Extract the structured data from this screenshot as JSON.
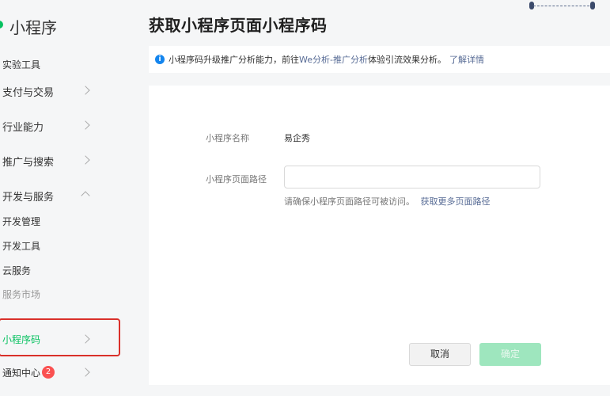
{
  "sidebar": {
    "app_title": "小程序",
    "items": [
      {
        "label": "实验工具"
      },
      {
        "label": "支付与交易"
      },
      {
        "label": "行业能力"
      },
      {
        "label": "推广与搜索"
      },
      {
        "label": "开发与服务"
      },
      {
        "label": "开发管理"
      },
      {
        "label": "开发工具"
      },
      {
        "label": "云服务"
      },
      {
        "label": "服务市场"
      },
      {
        "label": "小程序码"
      },
      {
        "label": "通知中心",
        "badge": "2"
      }
    ]
  },
  "main": {
    "title": "获取小程序页面小程序码",
    "notice": {
      "icon": "info-icon",
      "text_before": "小程序码升级推广分析能力，前往",
      "link1": "We分析-推广分析",
      "text_after": "体验引流效果分析。",
      "link2": "了解详情"
    },
    "form": {
      "name_label": "小程序名称",
      "name_value": "易企秀",
      "path_label": "小程序页面路径",
      "path_value": "",
      "hint_text": "请确保小程序页面路径可被访问。",
      "hint_link": "获取更多页面路径"
    },
    "buttons": {
      "cancel": "取消",
      "confirm": "确定"
    }
  },
  "colors": {
    "accent": "#07c160",
    "link": "#576b95",
    "highlight_border": "#d9302a",
    "badge": "#fa5151",
    "info": "#1485ee"
  }
}
